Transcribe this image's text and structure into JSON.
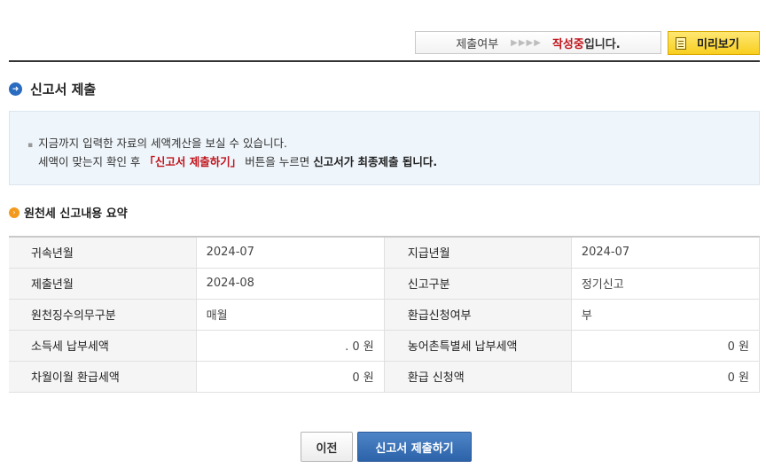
{
  "status": {
    "label": "제출여부",
    "arrows": "▶▶▶▶",
    "value": "작성중",
    "suffix": "입니다."
  },
  "preview_button": {
    "label": "미리보기"
  },
  "section_title": "신고서 제출",
  "info": {
    "bullet": "▪",
    "line1": "지금까지 입력한 자료의 세액계산을 보실 수 있습니다.",
    "line2_pre": "세액이 맞는지 확인 후 ",
    "line2_highlight": "「신고서 제출하기」",
    "line2_mid": " 버튼을 누르면 ",
    "line2_bold": "신고서가 최종제출 됩니다."
  },
  "summary": {
    "title": "원천세 신고내용 요약",
    "rows": [
      {
        "label1": "귀속년월",
        "value1": "2024-07",
        "label2": "지급년월",
        "value2": "2024-07"
      },
      {
        "label1": "제출년월",
        "value1": "2024-08",
        "label2": "신고구분",
        "value2": "정기신고"
      },
      {
        "label1": "원천징수의무구분",
        "value1": "매월",
        "label2": "환급신청여부",
        "value2": "부"
      },
      {
        "label1": "소득세 납부세액",
        "value1": ". 0 원",
        "label2": "농어촌특별세 납부세액",
        "value2": "0 원"
      },
      {
        "label1": "차월이월 환급세액",
        "value1": "0 원",
        "label2": "환급 신청액",
        "value2": "0 원"
      }
    ]
  },
  "buttons": {
    "prev": "이전",
    "submit": "신고서 제출하기"
  },
  "colors": {
    "accent_red": "#c0141b",
    "primary_blue": "#2c63a9",
    "preview_yellow": "#f8cf1f"
  }
}
